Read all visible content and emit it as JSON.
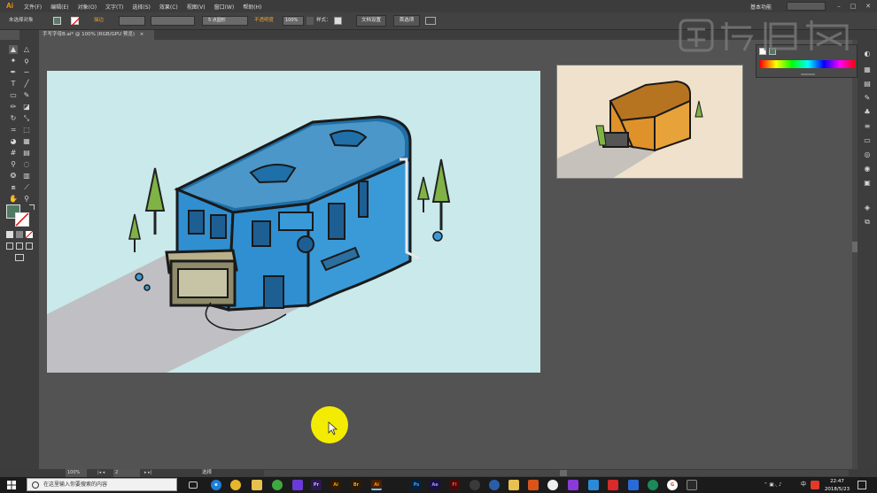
{
  "app": {
    "logo": "Ai",
    "menus": [
      "文件(F)",
      "编辑(E)",
      "对象(O)",
      "文字(T)",
      "选择(S)",
      "效果(C)",
      "视图(V)",
      "窗口(W)",
      "帮助(H)"
    ],
    "workspace": "基本功能",
    "window_controls": [
      "–",
      "□",
      "✕"
    ]
  },
  "control_bar": {
    "selection_label": "未选择对象",
    "stroke_label": "描边",
    "point_value": "5 点圆形",
    "opacity_label": "不透明度",
    "opacity_value": "100%",
    "style_label": "样式：",
    "doc_setup_button": "文档设置",
    "prefs_button": "首选项"
  },
  "document": {
    "tab_title": "手写字母B.ai* @ 100% (RGB/GPU 预览)",
    "tab_close": "×"
  },
  "status_bar": {
    "zoom": "100%",
    "artboard_number": "2",
    "tool_name": "选择"
  },
  "taskbar": {
    "search_placeholder": "在这里输入你要搜索的内容",
    "apps": [
      "Pr",
      "Ai",
      "Br",
      "Ai",
      "Ps",
      "Ae",
      "Fl"
    ],
    "clock_time": "22:47",
    "clock_date": "2018/5/23",
    "ime": "中"
  },
  "colors": {
    "accent_ai": "#ff9a00",
    "artboard_bg": "#c9e9ea",
    "building_blue": "#2f8fd1",
    "reference_bg": "#efe1cb",
    "building_orange": "#e0922a",
    "cursor_highlight": "#f4ec00"
  }
}
